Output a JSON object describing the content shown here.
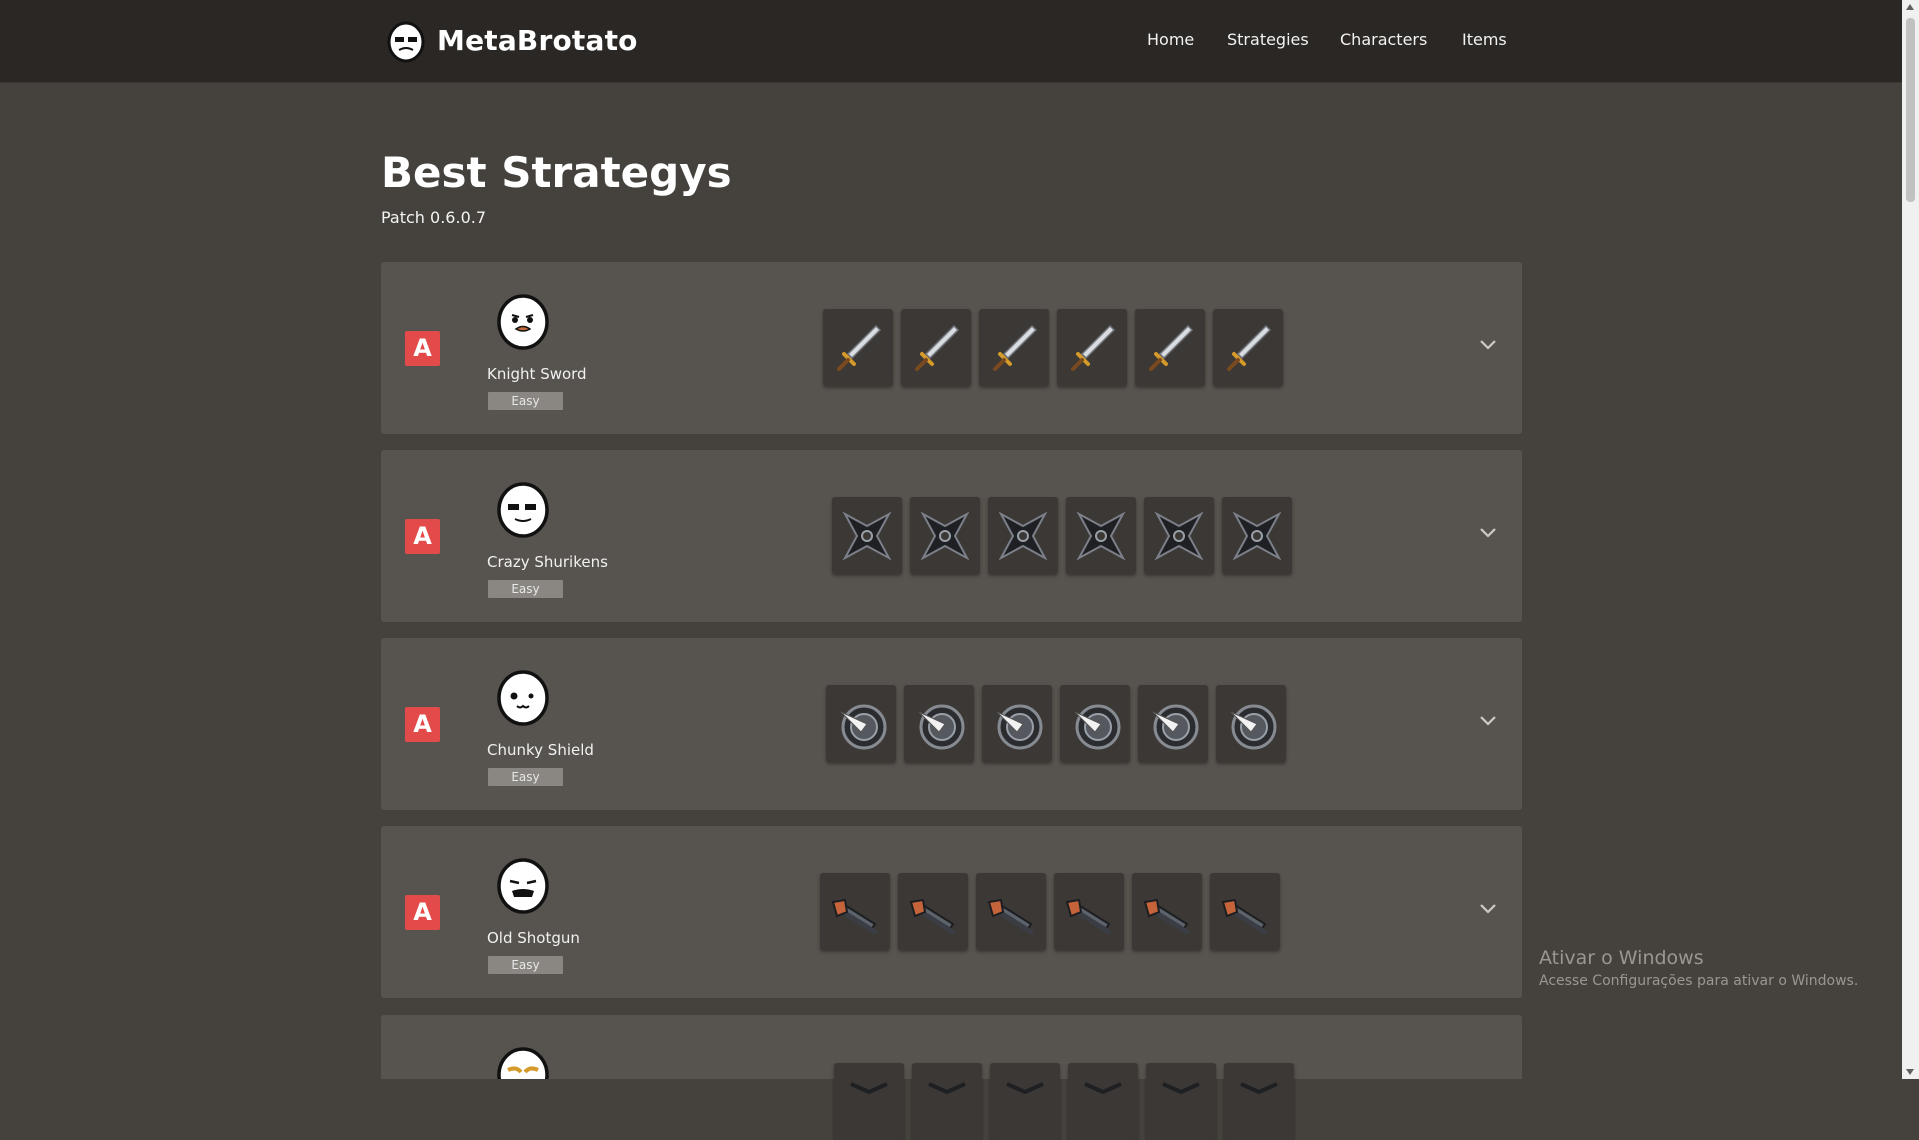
{
  "header": {
    "brand": "MetaBrotato",
    "nav": [
      "Home",
      "Strategies",
      "Characters",
      "Items"
    ]
  },
  "page": {
    "title": "Best Strategys",
    "patch": "Patch 0.6.0.7"
  },
  "strategies": [
    {
      "tier": "A",
      "name": "Knight Sword",
      "difficulty": "Easy",
      "item": "sword-icon",
      "item_count": 6
    },
    {
      "tier": "A",
      "name": "Crazy Shurikens",
      "difficulty": "Easy",
      "item": "shuriken-icon",
      "item_count": 6
    },
    {
      "tier": "A",
      "name": "Chunky Shield",
      "difficulty": "Easy",
      "item": "spiked-shield-icon",
      "item_count": 6
    },
    {
      "tier": "A",
      "name": "Old Shotgun",
      "difficulty": "Easy",
      "item": "shotgun-icon",
      "item_count": 6
    },
    {
      "tier": "",
      "name": "",
      "difficulty": "",
      "item": "item-icon",
      "item_count": 6
    }
  ],
  "watermark": {
    "title": "Ativar o Windows",
    "subtitle": "Acesse Configurações para ativar o Windows."
  },
  "colors": {
    "background": "#45423d",
    "topbar": "#2a2724",
    "card": "#57534e",
    "tier_badge": "#e34b4b",
    "difficulty_badge": "#8a8682"
  }
}
